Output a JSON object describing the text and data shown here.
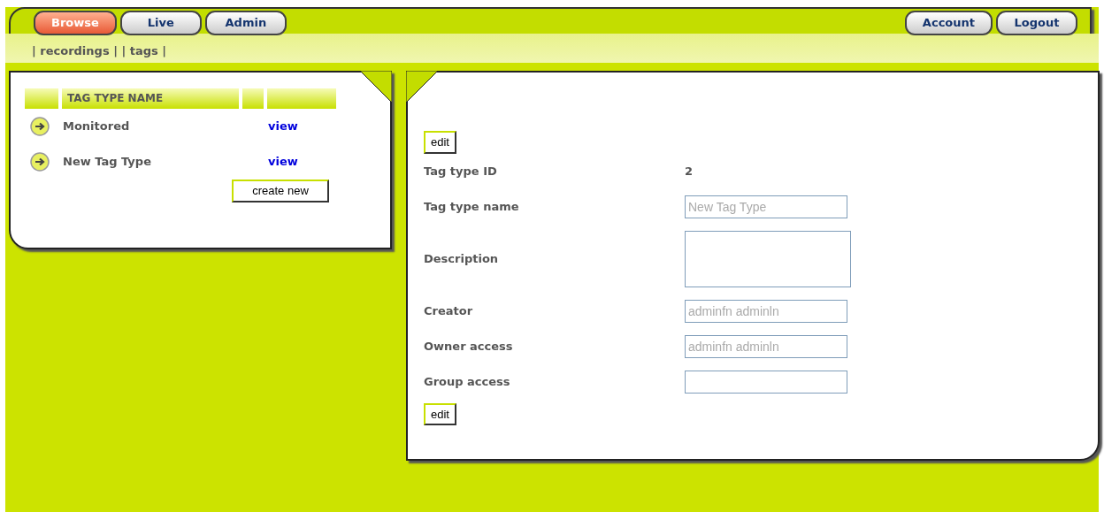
{
  "top_nav": {
    "left": [
      {
        "label": "Browse",
        "selected": true
      },
      {
        "label": "Live",
        "selected": false
      },
      {
        "label": "Admin",
        "selected": false
      }
    ],
    "right": [
      {
        "label": "Account"
      },
      {
        "label": "Logout"
      }
    ]
  },
  "sub_nav": {
    "separator": "|",
    "items": [
      {
        "label": "recordings"
      },
      {
        "label": "tags"
      }
    ]
  },
  "tag_types": {
    "columns": [
      "TAG TYPE NAME"
    ],
    "rows": [
      {
        "name": "Monitored",
        "action": "view"
      },
      {
        "name": "New Tag Type",
        "action": "view"
      }
    ],
    "create_button": "create new"
  },
  "detail": {
    "top_button": "edit",
    "bottom_button": "edit",
    "fields": [
      {
        "kind": "text",
        "label": "Tag type ID",
        "value": "2"
      },
      {
        "kind": "input",
        "label": "Tag type name",
        "placeholder": "New Tag Type"
      },
      {
        "kind": "textarea",
        "label": "Description"
      },
      {
        "kind": "input",
        "label": "Creator",
        "placeholder": "adminfn adminln"
      },
      {
        "kind": "input",
        "label": "Owner access",
        "placeholder": "adminfn adminln"
      },
      {
        "kind": "input",
        "label": "Group access"
      }
    ]
  }
}
